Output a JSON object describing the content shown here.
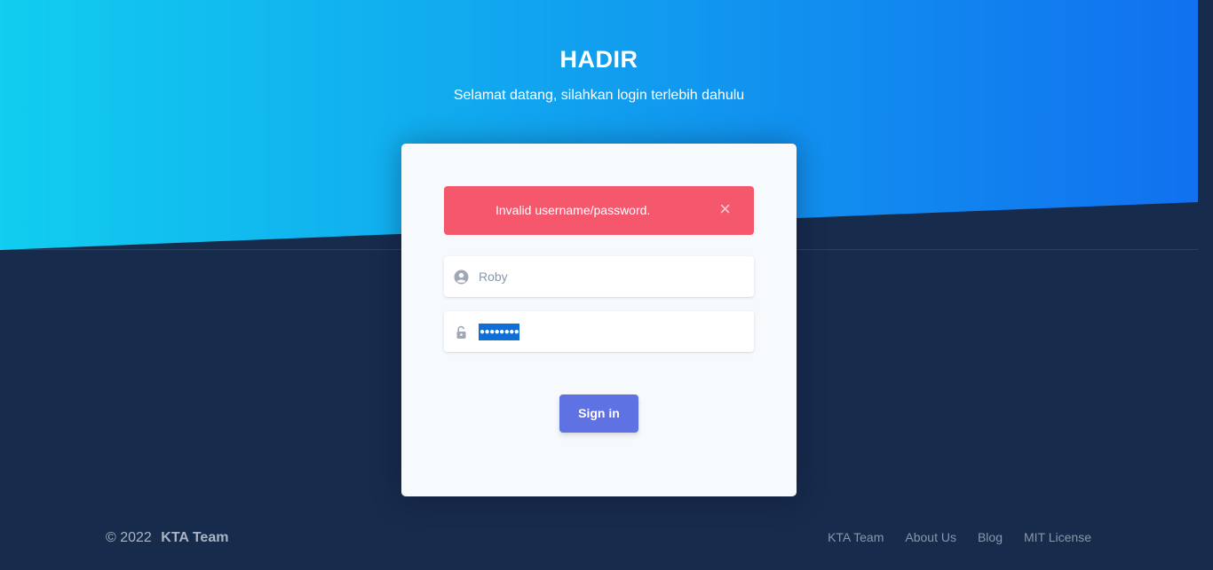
{
  "header": {
    "title": "HADIR",
    "subtitle": "Selamat datang, silahkan login terlebih dahulu"
  },
  "alert": {
    "message": "Invalid username/password.",
    "close_symbol": "×"
  },
  "form": {
    "username": {
      "value": "Roby",
      "icon": "user-circle-icon"
    },
    "password": {
      "masked_value": "●●●●●●●●",
      "icon": "lock-open-icon",
      "selected": true
    },
    "signin_label": "Sign in"
  },
  "footer": {
    "copyright_prefix": "© 2022",
    "team": "KTA Team",
    "links": [
      "KTA Team",
      "About Us",
      "Blog",
      "MIT License"
    ]
  },
  "colors": {
    "gradient_start": "#11cdef",
    "gradient_end": "#1171ef",
    "background": "#172b4d",
    "alert": "#f5576c",
    "primary": "#5e72e4",
    "card": "#f7fafc"
  }
}
